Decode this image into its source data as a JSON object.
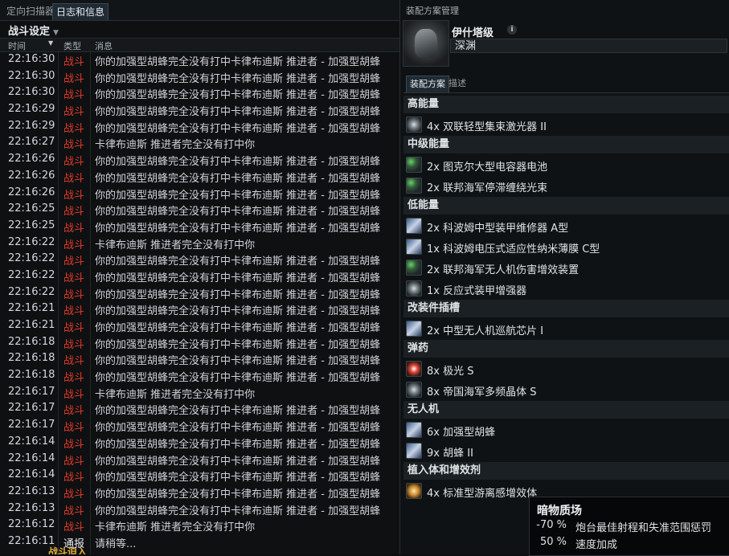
{
  "log_window": {
    "tabs": [
      {
        "label": "定向扫描器",
        "active": false
      },
      {
        "label": "日志和信息",
        "active": true
      }
    ],
    "section_title": "战斗设定",
    "columns": {
      "time": "时间",
      "type": "类型",
      "message": "消息"
    },
    "rows": [
      {
        "time": "22:16:30",
        "type": "战斗",
        "msg": "你的加强型胡蜂完全没有打中卡律布迪斯 推进者 - 加强型胡蜂"
      },
      {
        "time": "22:16:30",
        "type": "战斗",
        "msg": "你的加强型胡蜂完全没有打中卡律布迪斯 推进者 - 加强型胡蜂"
      },
      {
        "time": "22:16:30",
        "type": "战斗",
        "msg": "你的加强型胡蜂完全没有打中卡律布迪斯 推进者 - 加强型胡蜂"
      },
      {
        "time": "22:16:29",
        "type": "战斗",
        "msg": "你的加强型胡蜂完全没有打中卡律布迪斯 推进者 - 加强型胡蜂"
      },
      {
        "time": "22:16:29",
        "type": "战斗",
        "msg": "你的加强型胡蜂完全没有打中卡律布迪斯 推进者 - 加强型胡蜂"
      },
      {
        "time": "22:16:27",
        "type": "战斗",
        "msg": "卡律布迪斯 推进者完全没有打中你"
      },
      {
        "time": "22:16:26",
        "type": "战斗",
        "msg": "你的加强型胡蜂完全没有打中卡律布迪斯 推进者 - 加强型胡蜂"
      },
      {
        "time": "22:16:26",
        "type": "战斗",
        "msg": "你的加强型胡蜂完全没有打中卡律布迪斯 推进者 - 加强型胡蜂"
      },
      {
        "time": "22:16:26",
        "type": "战斗",
        "msg": "你的加强型胡蜂完全没有打中卡律布迪斯 推进者 - 加强型胡蜂"
      },
      {
        "time": "22:16:25",
        "type": "战斗",
        "msg": "你的加强型胡蜂完全没有打中卡律布迪斯 推进者 - 加强型胡蜂"
      },
      {
        "time": "22:16:25",
        "type": "战斗",
        "msg": "你的加强型胡蜂完全没有打中卡律布迪斯 推进者 - 加强型胡蜂"
      },
      {
        "time": "22:16:22",
        "type": "战斗",
        "msg": "卡律布迪斯 推进者完全没有打中你"
      },
      {
        "time": "22:16:22",
        "type": "战斗",
        "msg": "你的加强型胡蜂完全没有打中卡律布迪斯 推进者 - 加强型胡蜂"
      },
      {
        "time": "22:16:22",
        "type": "战斗",
        "msg": "你的加强型胡蜂完全没有打中卡律布迪斯 推进者 - 加强型胡蜂"
      },
      {
        "time": "22:16:22",
        "type": "战斗",
        "msg": "你的加强型胡蜂完全没有打中卡律布迪斯 推进者 - 加强型胡蜂"
      },
      {
        "time": "22:16:21",
        "type": "战斗",
        "msg": "你的加强型胡蜂完全没有打中卡律布迪斯 推进者 - 加强型胡蜂"
      },
      {
        "time": "22:16:21",
        "type": "战斗",
        "msg": "你的加强型胡蜂完全没有打中卡律布迪斯 推进者 - 加强型胡蜂"
      },
      {
        "time": "22:16:18",
        "type": "战斗",
        "msg": "你的加强型胡蜂完全没有打中卡律布迪斯 推进者 - 加强型胡蜂"
      },
      {
        "time": "22:16:18",
        "type": "战斗",
        "msg": "你的加强型胡蜂完全没有打中卡律布迪斯 推进者 - 加强型胡蜂"
      },
      {
        "time": "22:16:18",
        "type": "战斗",
        "msg": "你的加强型胡蜂完全没有打中卡律布迪斯 推进者 - 加强型胡蜂"
      },
      {
        "time": "22:16:17",
        "type": "战斗",
        "msg": "卡律布迪斯 推进者完全没有打中你"
      },
      {
        "time": "22:16:17",
        "type": "战斗",
        "msg": "你的加强型胡蜂完全没有打中卡律布迪斯 推进者 - 加强型胡蜂"
      },
      {
        "time": "22:16:17",
        "type": "战斗",
        "msg": "你的加强型胡蜂完全没有打中卡律布迪斯 推进者 - 加强型胡蜂"
      },
      {
        "time": "22:16:14",
        "type": "战斗",
        "msg": "你的加强型胡蜂完全没有打中卡律布迪斯 推进者 - 加强型胡蜂"
      },
      {
        "time": "22:16:14",
        "type": "战斗",
        "msg": "你的加强型胡蜂完全没有打中卡律布迪斯 推进者 - 加强型胡蜂"
      },
      {
        "time": "22:16:14",
        "type": "战斗",
        "msg": "你的加强型胡蜂完全没有打中卡律布迪斯 推进者 - 加强型胡蜂"
      },
      {
        "time": "22:16:13",
        "type": "战斗",
        "msg": "你的加强型胡蜂完全没有打中卡律布迪斯 推进者 - 加强型胡蜂"
      },
      {
        "time": "22:16:13",
        "type": "战斗",
        "msg": "你的加强型胡蜂完全没有打中卡律布迪斯 推进者 - 加强型胡蜂"
      },
      {
        "time": "22:16:12",
        "type": "战斗",
        "msg": "卡律布迪斯 推进者完全没有打中你"
      },
      {
        "time": "22:16:11",
        "type": "通报",
        "msg": "请稍等..."
      }
    ],
    "bottom_strip_text": "战斗迫入"
  },
  "fitting_window": {
    "title": "装配方案管理",
    "ship_name": "伊什塔级",
    "fit_name": "深渊",
    "tabs": [
      {
        "label": "装配方案",
        "active": true
      },
      {
        "label": "描述",
        "active": false
      }
    ],
    "groups": [
      {
        "name": "高能量",
        "items": [
          {
            "text": "4x 双联轻型集束激光器 II",
            "icon": "laser-icon",
            "style": "glow"
          }
        ]
      },
      {
        "name": "中级能量",
        "items": [
          {
            "text": "2x 图克尔大型电容器电池",
            "icon": "capacitor-battery-icon",
            "style": "green"
          },
          {
            "text": "2x 联邦海军停滞缠绕光束",
            "icon": "stasis-web-icon",
            "style": "green"
          }
        ]
      },
      {
        "name": "低能量",
        "items": [
          {
            "text": "2x 科波姆中型装甲维修器 A型",
            "icon": "armor-repairer-icon",
            "style": "blue"
          },
          {
            "text": "1x 科波姆电压式适应性纳米薄膜 C型",
            "icon": "nanomembrane-icon",
            "style": "blue"
          },
          {
            "text": "2x 联邦海军无人机伤害增效装置",
            "icon": "drone-damage-amplifier-icon",
            "style": "green"
          },
          {
            "text": "1x 反应式装甲增强器",
            "icon": "reactive-armor-icon",
            "style": "glow"
          }
        ]
      },
      {
        "name": "改装件插槽",
        "items": [
          {
            "text": "2x 中型无人机巡航芯片 I",
            "icon": "drone-rig-icon",
            "style": "blue"
          }
        ]
      },
      {
        "name": "弹药",
        "items": [
          {
            "text": "8x 极光 S",
            "icon": "aurora-crystal-icon",
            "style": "red"
          },
          {
            "text": "8x 帝国海军多频晶体 S",
            "icon": "multifrequency-crystal-icon",
            "style": "glow"
          }
        ]
      },
      {
        "name": "无人机",
        "items": [
          {
            "text": "6x 加强型胡蜂",
            "icon": "drone-icon",
            "style": "blue"
          },
          {
            "text": "9x 胡蜂 II",
            "icon": "drone-icon",
            "style": "blue"
          }
        ]
      },
      {
        "name": "植入体和增效剂",
        "items": [
          {
            "text": "4x 标准型游离感增效体",
            "icon": "booster-icon",
            "style": "amber"
          }
        ]
      }
    ]
  },
  "tooltip": {
    "title": "暗物质场",
    "rows": [
      {
        "pct": "-70 %",
        "desc": "炮台最佳射程和失准范围惩罚"
      },
      {
        "pct": "50 %",
        "desc": "速度加成"
      }
    ]
  }
}
